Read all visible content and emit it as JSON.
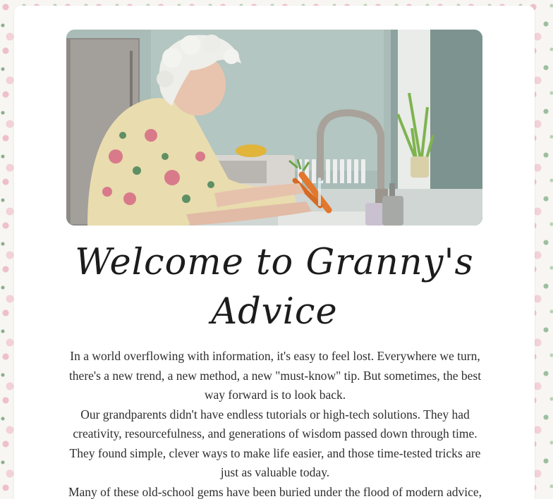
{
  "hero": {
    "image_alt": "Elderly woman rinsing carrots at a kitchen sink"
  },
  "title": "Welcome to Granny's Advice",
  "paragraphs": [
    "In a world overflowing with information, it's easy to feel lost. Everywhere we turn, there's a new trend, a new method, a new \"must-know\" tip. But sometimes, the best way forward is to look back.",
    "Our grandparents didn't have endless tutorials or high-tech solutions. They had creativity, resourcefulness, and generations of wisdom passed down through time. They found simple, clever ways to make life easier, and those time-tested tricks are just as valuable today.",
    "Many of these old-school gems have been buried under the flood of modern advice, but"
  ],
  "colors": {
    "card_background": "#ffffff",
    "text": "#2e2e2e",
    "title": "#1c1c1c",
    "floral_background": "#f7f4ef"
  }
}
